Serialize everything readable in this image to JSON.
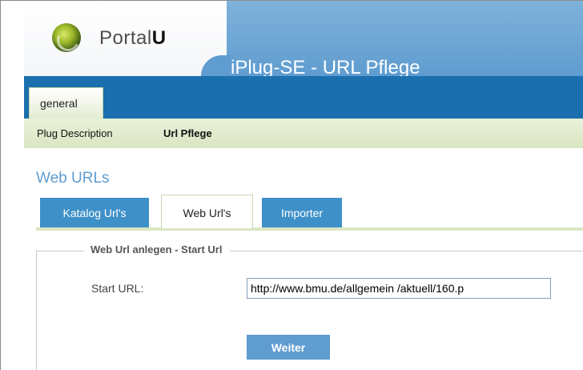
{
  "header": {
    "logo_text_light": "Portal",
    "logo_text_bold": "U",
    "app_title": "iPlug-SE - URL Pflege"
  },
  "main_nav": {
    "tabs": [
      {
        "label": "general",
        "active": true
      }
    ]
  },
  "sub_nav": {
    "items": [
      {
        "label": "Plug Description",
        "active": false
      },
      {
        "label": "Url Pflege",
        "active": true
      }
    ]
  },
  "content": {
    "section_title": "Web URLs",
    "tabs": [
      {
        "label": "Katalog Url's",
        "active": false
      },
      {
        "label": "Web Url's",
        "active": true
      },
      {
        "label": "Importer",
        "active": false
      }
    ],
    "form": {
      "legend": "Web Url anlegen - Start Url",
      "start_url_label": "Start URL:",
      "start_url_value": "http://www.bmu.de/allgemein /aktuell/160.p",
      "submit_label": "Weiter"
    }
  },
  "colors": {
    "banner_blue": "#5f9cd0",
    "nav_dark_blue": "#1b6fae",
    "subnav_green": "#dbe6c3",
    "tab_blue": "#3e90c8"
  },
  "icons": {
    "logo": "portal-u-globe-icon"
  }
}
